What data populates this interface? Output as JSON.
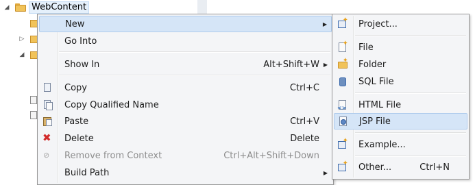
{
  "tree": {
    "root_label": "WebContent"
  },
  "menu": {
    "items": [
      {
        "label": "New",
        "accel": "",
        "submenu": true
      },
      {
        "label": "Go Into",
        "accel": ""
      },
      {
        "label": "Show In",
        "accel": "Alt+Shift+W",
        "submenu": true
      },
      {
        "label": "Copy",
        "accel": "Ctrl+C",
        "icon": "copy-icon"
      },
      {
        "label": "Copy Qualified Name",
        "accel": "",
        "icon": "copy-qualified-name-icon"
      },
      {
        "label": "Paste",
        "accel": "Ctrl+V",
        "icon": "paste-icon"
      },
      {
        "label": "Delete",
        "accel": "Delete",
        "icon": "delete-icon"
      },
      {
        "label": "Remove from Context",
        "accel": "Ctrl+Alt+Shift+Down",
        "icon": "remove-context-icon",
        "disabled": true
      },
      {
        "label": "Build Path",
        "accel": "",
        "submenu": true
      }
    ]
  },
  "submenu": {
    "items": [
      {
        "label": "Project...",
        "icon": "new-project-icon"
      },
      {
        "label": "File",
        "icon": "new-file-icon"
      },
      {
        "label": "Folder",
        "icon": "new-folder-icon"
      },
      {
        "label": "SQL File",
        "icon": "sql-file-icon"
      },
      {
        "label": "HTML File",
        "icon": "html-file-icon"
      },
      {
        "label": "JSP File",
        "icon": "jsp-file-icon",
        "highlighted": true
      },
      {
        "label": "Example...",
        "icon": "example-icon"
      },
      {
        "label": "Other...",
        "accel": "Ctrl+N",
        "icon": "other-wizard-icon"
      }
    ]
  },
  "colors": {
    "menu_bg": "#f4f5f7",
    "highlight_bg": "#d5e5f7",
    "highlight_border": "#aecbed",
    "disabled_text": "#8d8d8d",
    "delete_red": "#d22a2a"
  }
}
